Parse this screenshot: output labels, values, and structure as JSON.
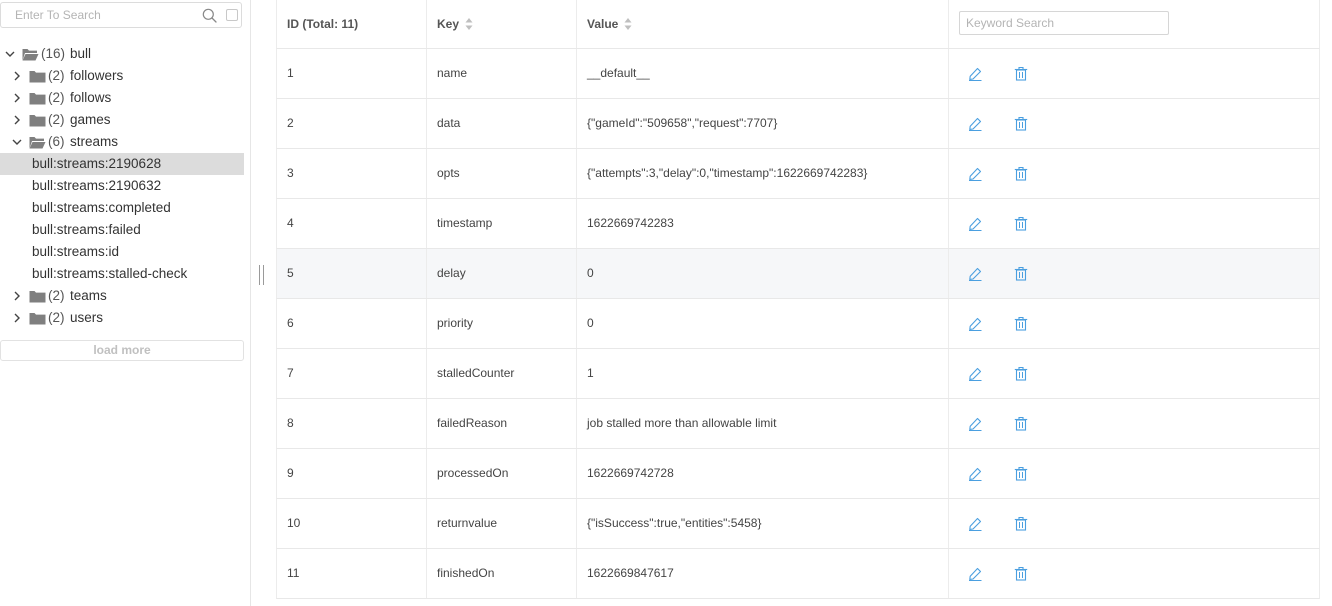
{
  "sidebar": {
    "search": {
      "placeholder": "Enter To Search",
      "value": ""
    },
    "tree": [
      {
        "type": "folder",
        "level": 0,
        "expanded": true,
        "count": "(16)",
        "name": "bull"
      },
      {
        "type": "folder",
        "level": 1,
        "expanded": false,
        "count": "(2)",
        "name": "followers"
      },
      {
        "type": "folder",
        "level": 1,
        "expanded": false,
        "count": "(2)",
        "name": "follows"
      },
      {
        "type": "folder",
        "level": 1,
        "expanded": false,
        "count": "(2)",
        "name": "games"
      },
      {
        "type": "folder",
        "level": 1,
        "expanded": true,
        "count": "(6)",
        "name": "streams"
      },
      {
        "type": "key",
        "name": "bull:streams:2190628",
        "selected": true
      },
      {
        "type": "key",
        "name": "bull:streams:2190632"
      },
      {
        "type": "key",
        "name": "bull:streams:completed"
      },
      {
        "type": "key",
        "name": "bull:streams:failed"
      },
      {
        "type": "key",
        "name": "bull:streams:id"
      },
      {
        "type": "key",
        "name": "bull:streams:stalled-check"
      },
      {
        "type": "folder",
        "level": 1,
        "expanded": false,
        "count": "(2)",
        "name": "teams"
      },
      {
        "type": "folder",
        "level": 1,
        "expanded": false,
        "count": "(2)",
        "name": "users"
      }
    ],
    "load_more": "load more"
  },
  "table": {
    "headers": {
      "id": "ID (Total: 11)",
      "key": "Key",
      "value": "Value"
    },
    "keyword_search_placeholder": "Keyword Search",
    "rows": [
      {
        "id": "1",
        "key": "name",
        "value": "__default__"
      },
      {
        "id": "2",
        "key": "data",
        "value": "{\"gameId\":\"509658\",\"request\":7707}"
      },
      {
        "id": "3",
        "key": "opts",
        "value": "{\"attempts\":3,\"delay\":0,\"timestamp\":1622669742283}"
      },
      {
        "id": "4",
        "key": "timestamp",
        "value": "1622669742283"
      },
      {
        "id": "5",
        "key": "delay",
        "value": "0"
      },
      {
        "id": "6",
        "key": "priority",
        "value": "0"
      },
      {
        "id": "7",
        "key": "stalledCounter",
        "value": "1"
      },
      {
        "id": "8",
        "key": "failedReason",
        "value": "job stalled more than allowable limit"
      },
      {
        "id": "9",
        "key": "processedOn",
        "value": "1622669742728"
      },
      {
        "id": "10",
        "key": "returnvalue",
        "value": "{\"isSuccess\":true,\"entities\":5458}"
      },
      {
        "id": "11",
        "key": "finishedOn",
        "value": "1622669847617"
      }
    ],
    "hover_row": 5
  },
  "icons": {
    "edit": "edit-pencil-icon",
    "delete": "trash-icon",
    "folder": "folder-icon",
    "search": "search-icon"
  },
  "colors": {
    "accent": "#4a9fe0",
    "selected_row": "#dcdcdc",
    "hover_row": "#f6f7f9"
  }
}
